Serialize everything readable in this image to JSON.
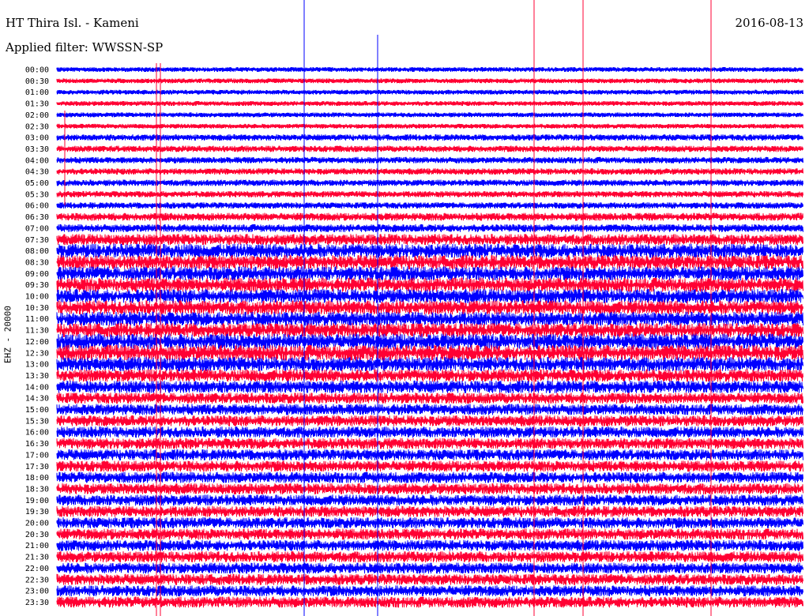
{
  "header": {
    "station": "HT Thira Isl. - Kameni",
    "filter": "Applied filter: WWSSN-SP",
    "date": "2016-08-13",
    "channel_label": "EHZ - 20000"
  },
  "colors": {
    "a": "#0000ff",
    "b": "#ff0033",
    "text": "#000000"
  },
  "chart_data": {
    "type": "helicorder",
    "rows": [
      "00:00",
      "00:30",
      "01:00",
      "01:30",
      "02:00",
      "02:30",
      "03:00",
      "03:30",
      "04:00",
      "04:30",
      "05:00",
      "05:30",
      "06:00",
      "06:30",
      "07:00",
      "07:30",
      "08:00",
      "08:30",
      "09:00",
      "09:30",
      "10:00",
      "10:30",
      "11:00",
      "11:30",
      "12:00",
      "12:30",
      "13:00",
      "13:30",
      "14:00",
      "14:30",
      "15:00",
      "15:30",
      "16:00",
      "16:30",
      "17:00",
      "17:30",
      "18:00",
      "18:30",
      "19:00",
      "19:30",
      "20:00",
      "20:30",
      "21:00",
      "21:30",
      "22:00",
      "22:30",
      "23:00",
      "23:30"
    ],
    "row_amplitude": [
      2,
      2,
      2,
      2,
      2,
      2,
      3,
      3,
      3,
      3,
      3,
      3,
      3,
      4,
      4,
      6,
      8,
      8,
      8,
      8,
      8,
      8,
      8,
      8,
      9,
      9,
      8,
      7,
      7,
      6,
      6,
      6,
      6,
      6,
      6,
      6,
      6,
      6,
      6,
      6,
      6,
      6,
      6,
      6,
      6,
      6,
      6,
      6
    ],
    "row_colors": [
      "a",
      "b",
      "a",
      "b",
      "a",
      "b",
      "a",
      "b",
      "a",
      "b",
      "a",
      "b",
      "a",
      "b",
      "a",
      "b",
      "a",
      "b",
      "a",
      "b",
      "a",
      "b",
      "a",
      "b",
      "a",
      "b",
      "a",
      "b",
      "a",
      "b",
      "a",
      "b",
      "a",
      "b",
      "a",
      "b",
      "a",
      "b",
      "a",
      "b",
      "a",
      "b",
      "a",
      "b",
      "a",
      "b",
      "a",
      "b"
    ]
  }
}
